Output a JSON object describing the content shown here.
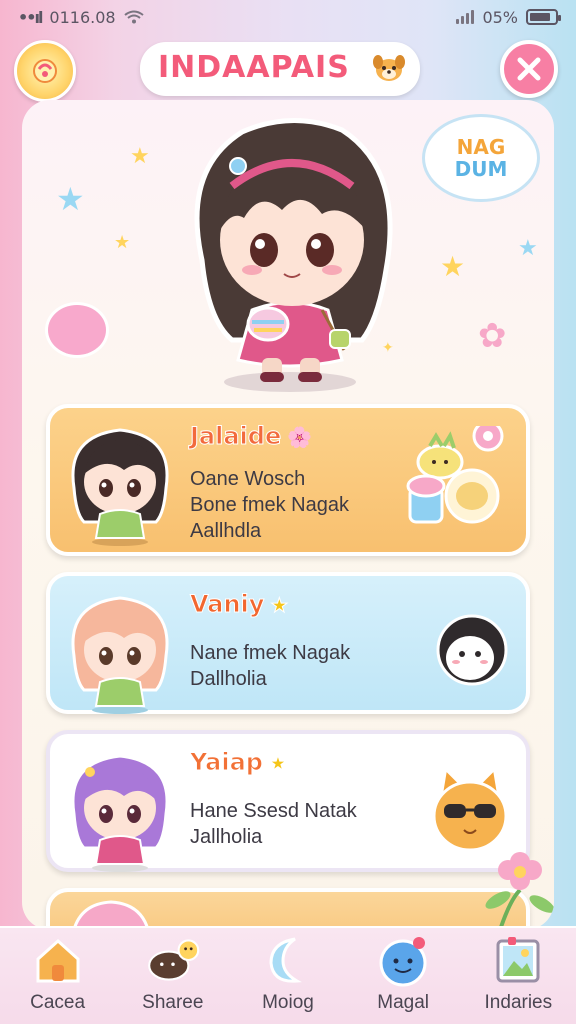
{
  "status_bar": {
    "time": "0116.08",
    "battery_text": "05%",
    "battery_level": 0.85
  },
  "header": {
    "title": "INDAAPAIS",
    "sun_icon": "sun-icon",
    "close_icon": "close-icon"
  },
  "hero": {
    "bubble_line1": "NAG",
    "bubble_line2": "DUM"
  },
  "cards": [
    {
      "name": "Jalaide",
      "desc_lines": [
        "Oane Wosch",
        "Bone fmek Nagak",
        "Aallhdla"
      ],
      "accent": "#f8c06f"
    },
    {
      "name": "Vaniy",
      "desc_lines": [
        "Nane fmek Nagak",
        "Dallholia"
      ],
      "accent": "#bfe6f7"
    },
    {
      "name": "Yaiap",
      "desc_lines": [
        "Hane Ssesd Natak",
        "Jallholia"
      ],
      "accent": "#ffffff"
    }
  ],
  "bottom_nav": [
    {
      "label": "Cacea",
      "icon": "house-icon"
    },
    {
      "label": "Sharee",
      "icon": "pet-icon"
    },
    {
      "label": "Moiog",
      "icon": "moon-icon"
    },
    {
      "label": "Magal",
      "icon": "blob-icon"
    },
    {
      "label": "Indaries",
      "icon": "picture-icon"
    }
  ]
}
